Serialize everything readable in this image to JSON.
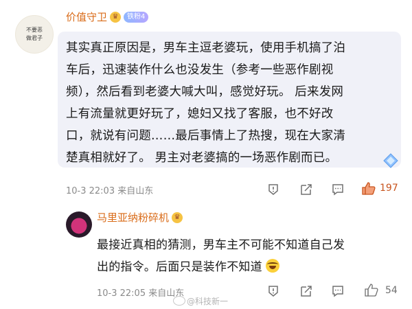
{
  "comment": {
    "avatar_text": [
      "不要恶",
      "做君子"
    ],
    "username": "价值守卫",
    "fan_badge": "铁粉4",
    "body_lines": [
      "其实真正原因是，男车主逗老婆玩，使用手机搞了泊",
      "车后，迅速装作什么也没发生（参考一些恶作剧视",
      "频），然后看到老婆大喊大叫，感觉好玩。 后来发网",
      "上有流量就更好玩了，媳妇又找了客服，也不好改",
      "口，就说有问题……最后事情上了热搜，现在大家清",
      "楚真相就好了。 男主对老婆搞的一场恶作剧而已。"
    ],
    "time": "10-3 22:03",
    "location": "来自山东",
    "like_count": "197",
    "actions": [
      "report-icon",
      "share-icon",
      "comment-icon",
      "like-icon"
    ],
    "accent_color": "#d96b18"
  },
  "reply": {
    "username": "马里亚纳粉碎机",
    "body_lines": [
      "最接近真相的猜测，男车主不可能不知道自己发",
      "出的指令。后面只是装作不知道"
    ],
    "time": "10-3 22:05",
    "location": "来自山东",
    "like_count": "54"
  },
  "watermark": "@科技新一"
}
